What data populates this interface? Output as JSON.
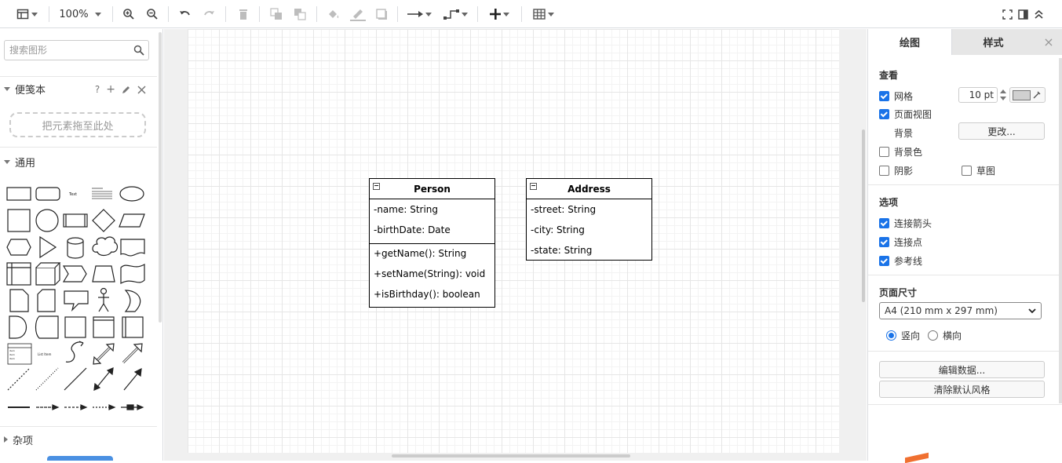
{
  "toolbar": {
    "zoom": "100%"
  },
  "left_panel": {
    "search_placeholder": "搜索图形",
    "scratchpad": {
      "title": "便笺本",
      "help": "?",
      "add": "+",
      "dropzone": "把元素拖至此处"
    },
    "general_title": "通用",
    "misc_title": "杂项"
  },
  "diagram": {
    "classes": [
      {
        "name": "Person",
        "attributes": [
          "-name: String",
          "-birthDate: Date"
        ],
        "methods": [
          "+getName(): String",
          "+setName(String): void",
          "+isBirthday(): boolean"
        ]
      },
      {
        "name": "Address",
        "attributes": [
          "-street: String",
          "-city: String",
          "-state: String"
        ],
        "methods": []
      }
    ]
  },
  "right_panel": {
    "tabs": {
      "draw": "绘图",
      "style": "样式",
      "close": "×"
    },
    "view_title": "查看",
    "grid_label": "网格",
    "grid_size": "10 pt",
    "page_view_label": "页面视图",
    "background_label": "背景",
    "change_button": "更改...",
    "bg_color_label": "背景色",
    "shadow_label": "阴影",
    "sketch_label": "草图",
    "options_title": "选项",
    "connection_arrows_label": "连接箭头",
    "connection_points_label": "连接点",
    "guides_label": "参考线",
    "paper_size_title": "页面尺寸",
    "paper_size_value": "A4 (210 mm x 297 mm)",
    "portrait_label": "竖向",
    "landscape_label": "横向",
    "edit_data_button": "编辑数据...",
    "clear_style_button": "清除默认风格"
  },
  "colors": {
    "accent": "#1a73e8",
    "grid_line": "#e6e6e6",
    "canvas_bg": "#f0f0f0"
  }
}
